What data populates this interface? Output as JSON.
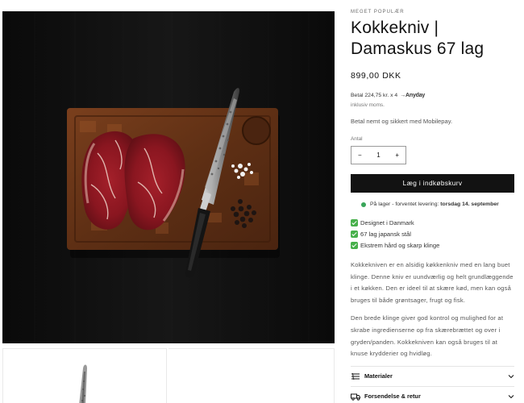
{
  "product": {
    "eyebrow": "MEGET POPULÆR",
    "title_line1": "Kokkekniv |",
    "title_line2": "Damaskus 67 lag",
    "price": "899,00 DKK",
    "installment_text": "Betal 224,75 kr. x 4",
    "installment_brand": "Anyday",
    "tax_note": "inklusiv moms.",
    "payment_note": "Betal nemt og sikkert med Mobilepay.",
    "quantity_label": "Antal",
    "quantity_value": "1",
    "minus_symbol": "−",
    "plus_symbol": "+",
    "add_to_cart_label": "Læg i indkøbskurv",
    "stock_prefix": "På lager - forventet levering:",
    "stock_date": "torsdag 14. september",
    "stock_color": "#3aa55a",
    "features": [
      "Designet i Danmark",
      "67 lag japansk stål",
      "Ekstrem hård og skarp klinge"
    ],
    "feature_icon": "check-box-icon",
    "feature_icon_color": "#47b04b",
    "description": [
      "Kokkekniven er en alsidig køkkenkniv med en lang buet klinge. Denne kniv er uundværlig og helt grundlæggende i et køkken. Den er ideel til at skære kød, men kan også bruges til både grøntsager, frugt og fisk.",
      "Den brede klinge giver god kontrol og mulighed for at skrabe ingredienserne op fra skærebrættet og over i gryden/panden. Kokkekniven kan også bruges til at knuse krydderier og hvidløg."
    ],
    "accordions": [
      {
        "label": "Materialer",
        "icon": "fabric-icon"
      },
      {
        "label": "Forsendelse & retur",
        "icon": "truck-icon"
      }
    ],
    "button_color": "#121212"
  }
}
